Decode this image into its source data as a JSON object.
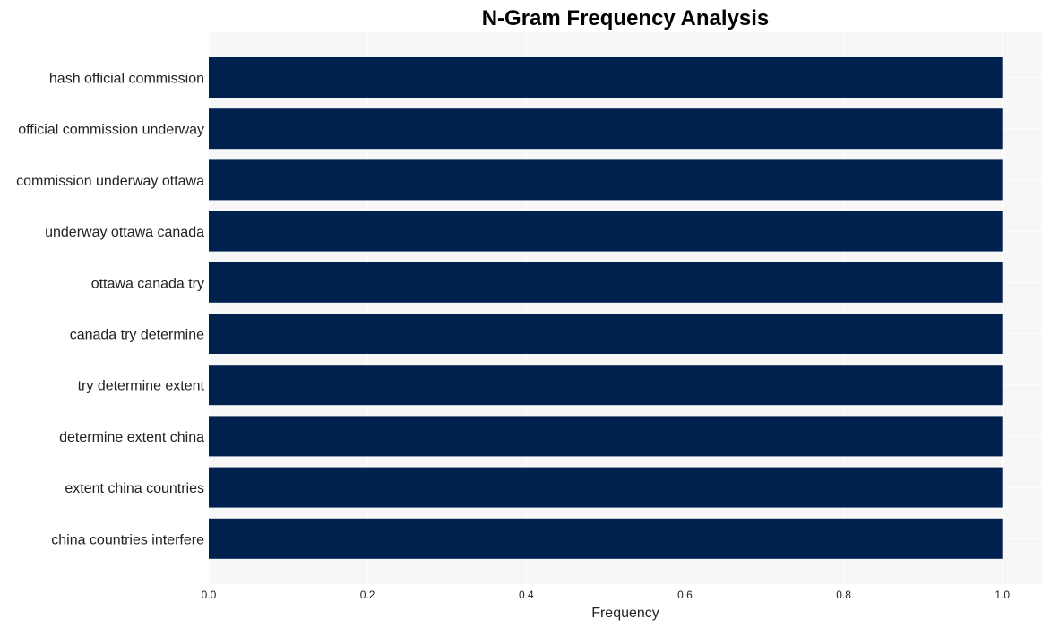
{
  "chart_data": {
    "type": "bar",
    "orientation": "horizontal",
    "title": "N-Gram Frequency Analysis",
    "xlabel": "Frequency",
    "ylabel": "",
    "categories": [
      "hash official commission",
      "official commission underway",
      "commission underway ottawa",
      "underway ottawa canada",
      "ottawa canada try",
      "canada try determine",
      "try determine extent",
      "determine extent china",
      "extent china countries",
      "china countries interfere"
    ],
    "values": [
      1,
      1,
      1,
      1,
      1,
      1,
      1,
      1,
      1,
      1
    ],
    "xlim": [
      0,
      1.05
    ],
    "xticks": [
      0.0,
      0.2,
      0.4,
      0.6,
      0.8,
      1.0
    ],
    "xtick_labels": [
      "0.0",
      "0.2",
      "0.4",
      "0.6",
      "0.8",
      "1.0"
    ],
    "grid": true,
    "legend": "none",
    "bar_color": "#00204e",
    "background_color": "#f7f7f7"
  }
}
